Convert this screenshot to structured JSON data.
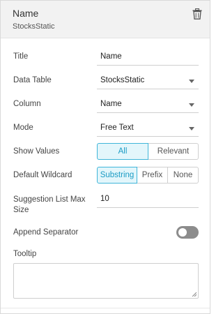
{
  "header": {
    "title": "Name",
    "subtitle": "StocksStatic"
  },
  "fields": {
    "title": {
      "label": "Title",
      "value": "Name"
    },
    "data_table": {
      "label": "Data Table",
      "value": "StocksStatic"
    },
    "column": {
      "label": "Column",
      "value": "Name"
    },
    "mode": {
      "label": "Mode",
      "value": "Free Text"
    },
    "show_values": {
      "label": "Show Values",
      "options": [
        "All",
        "Relevant"
      ],
      "selected": "All"
    },
    "default_wildcard": {
      "label": "Default Wildcard",
      "options": [
        "Substring",
        "Prefix",
        "None"
      ],
      "selected": "Substring"
    },
    "suggestion_max": {
      "label_line1": "Suggestion List Max",
      "label_line2": "Size",
      "value": "10"
    },
    "append_separator": {
      "label": "Append Separator",
      "on": false
    },
    "tooltip": {
      "label": "Tooltip",
      "value": ""
    }
  },
  "colors": {
    "accent": "#3fb5d9",
    "toggle_off": "#8c8c8c"
  },
  "icons": {
    "delete": "trash-icon",
    "dropdown": "chevron-down-icon",
    "resize": "resize-grip-icon"
  }
}
